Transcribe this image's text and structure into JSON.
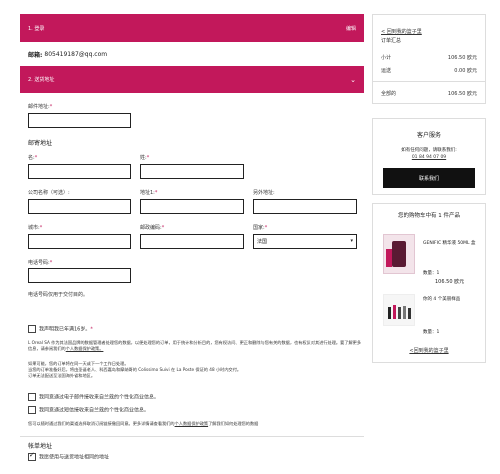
{
  "step1": {
    "label": "1. 登录",
    "action": "编辑"
  },
  "email": {
    "label": "邮箱:",
    "value": "805419187@qq.com"
  },
  "step2": {
    "label": "2. 送货地址",
    "chevron": "chevron-down-icon"
  },
  "form": {
    "postcode_label": "邮件地址:",
    "address_section": "邮寄地址",
    "lastname_label": "名:",
    "firstname_label": "姓:",
    "company_label": "公司名称（可选）:",
    "address1_label": "地址1:",
    "address2_label": "另外地址:",
    "city_label": "城市:",
    "zip_label": "邮政编码:",
    "country_label": "国家:",
    "country_value": "法国",
    "phone_label": "电话号码:",
    "phone_note": "电话号码仅用于交付目的。",
    "age_checkbox": "我声明我已年满16岁。",
    "privacy_text": "L Oreal SA 作为其法国品牌的数据管理者处理您的数据，以便处理您的订单，用于统计和分析目的，您有权访问、更正和删除与您有关的数据，也有权反对其进行处理。要了解更多信息，请参阅我们的",
    "privacy_link": "个人数据保护政策。",
    "shipping_text1": "如果可能，您的订单将在同一天或下一个工作日处理。",
    "shipping_text2": "当您的订单准备好后，将由圣诞老人、科西嘉岛和摩纳哥的 Colissimo Suivi 在 La Poste 保证的 48 小时内交付。",
    "shipping_text3": "订单无法配送至法国海外省和地区。",
    "newsletter1": "我同意通过电子邮件接收来自兰蔻的个性化商业信息。",
    "newsletter2": "我同意通过短信接收来自兰蔻的个性化商业信息。",
    "unsubscribe_text": "您可以随时通过我们的渠道选择取消订阅链接撤回同意。更多详情请查看我们的",
    "unsubscribe_link": "个人数据保护政策",
    "unsubscribe_tail": "了解我们如何处理您的数据",
    "billing_title": "帐单地址",
    "billing_same": "我愿使用与送货地址相同的地址"
  },
  "summary": {
    "back_link": "< 回到我的篮子里",
    "title": "订单汇总",
    "subtotal_label": "小计",
    "subtotal_value": "106.50 欧元",
    "shipping_label": "运送",
    "shipping_value": "0.00 欧元",
    "total_label": "全部的",
    "total_value": "106.50 欧元"
  },
  "service": {
    "title": "客户服务",
    "text": "如有任何问题，请联系我们:",
    "phone": "01 84 94 07 09",
    "button": "联系我们"
  },
  "cart": {
    "title": "您的购物车中有 1 件产品",
    "item1_name": "GENIFIC 精华液 50ML 盒",
    "item1_qty": "数量：1",
    "item1_price": "106.50 欧元",
    "item2_name": "你的 4 个美丽样品",
    "item2_qty": "数量：1",
    "back_link": "<回到我的篮子里"
  },
  "colors": {
    "accent": "#c2185b"
  }
}
